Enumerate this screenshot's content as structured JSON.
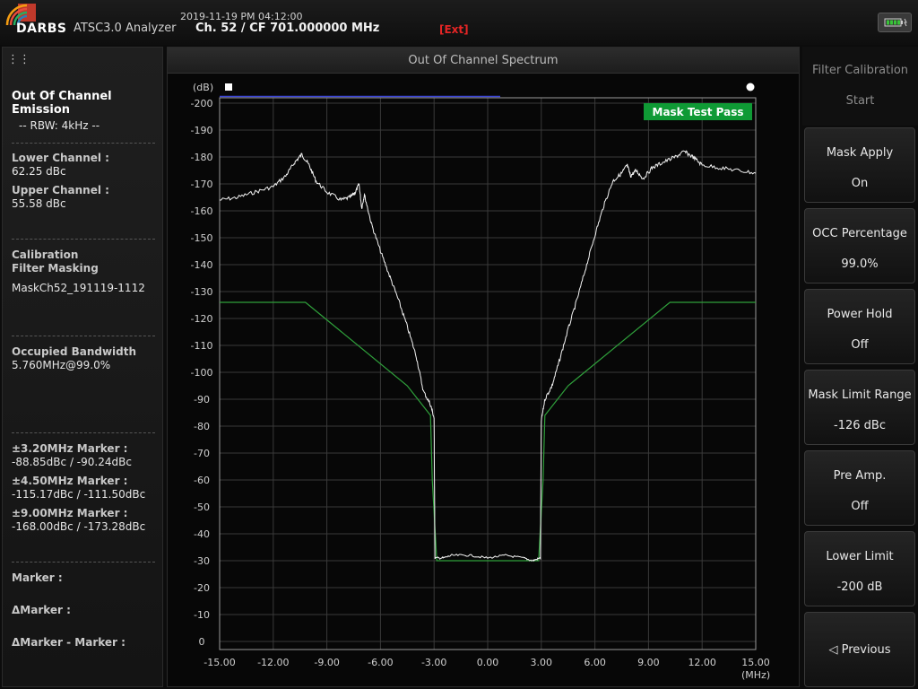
{
  "header": {
    "logo_text": "DARBS",
    "app_title": "ATSC3.0 Analyzer",
    "datetime": "2019-11-19 PM 04:12:00",
    "channel_info": "Ch. 52 / CF 701.000000 MHz",
    "ext_tag": "[Ext]",
    "icons": {
      "logo": "darbs-logo-icon",
      "battery": "battery-icon",
      "handle": "drag-handle-icon"
    }
  },
  "left_panel": {
    "title": "Out Of Channel Emission",
    "rbw": "-- RBW: 4kHz --",
    "lower_channel_label": "Lower Channel :",
    "lower_channel_value": "62.25 dBc",
    "upper_channel_label": "Upper Channel :",
    "upper_channel_value": "55.58 dBc",
    "calibration_label_1": "Calibration",
    "calibration_label_2": "Filter Masking",
    "mask_name": "MaskCh52_191119-1112",
    "occupied_bw_label": "Occupied Bandwidth",
    "occupied_bw_value": "5.760MHz@99.0%",
    "markers": [
      {
        "label": "±3.20MHz Marker :",
        "value": "-88.85dBc / -90.24dBc"
      },
      {
        "label": "±4.50MHz Marker :",
        "value": "-115.17dBc / -111.50dBc"
      },
      {
        "label": "±9.00MHz Marker :",
        "value": "-168.00dBc / -173.28dBc"
      }
    ],
    "marker_label": "Marker :",
    "delta_marker_label": "ΔMarker :",
    "delta_marker_minus_label": "ΔMarker - Marker :"
  },
  "center_panel": {
    "title": "Out Of Channel Spectrum",
    "badge": "Mask Test Pass"
  },
  "chart_data": {
    "type": "line",
    "ylabel": "(dB)",
    "xlabel": "(MHz)",
    "xlim": [
      -15,
      15
    ],
    "ylim": [
      -200,
      0
    ],
    "x_ticks": [
      -15,
      -12,
      -9,
      -6,
      -3,
      0,
      3,
      6,
      9,
      12,
      15
    ],
    "x_tick_labels": [
      "-15.00",
      "-12.00",
      "-9.00",
      "-6.00",
      "-3.00",
      "0.00",
      "3.00",
      "6.00",
      "9.00",
      "12.00",
      "15.00"
    ],
    "y_ticks": [
      0,
      -10,
      -20,
      -30,
      -40,
      -50,
      -60,
      -70,
      -80,
      -90,
      -100,
      -110,
      -120,
      -130,
      -140,
      -150,
      -160,
      -170,
      -180,
      -190,
      -200
    ],
    "grid": true,
    "colors": {
      "spectrum": "#f4f4f4",
      "mask": "#2fa03b",
      "baseline": "#3b45d8",
      "badge": "#0f9a35",
      "grid": "#3a3a3a"
    },
    "series": [
      {
        "role": "spectrum",
        "x": [
          -15,
          -14,
          -13,
          -12,
          -11.3,
          -10.8,
          -10.4,
          -10,
          -9.6,
          -9,
          -8.2,
          -7.7,
          -7.4,
          -7.2,
          -7.05,
          -6.9,
          -6.5,
          -6,
          -5.5,
          -5,
          -4.5,
          -4,
          -3.6,
          -3.2,
          -3,
          -2.95,
          -2.5,
          -2,
          -1,
          0,
          1,
          2,
          2.5,
          2.95,
          3,
          3.2,
          3.6,
          4,
          4.5,
          5,
          5.5,
          6,
          6.5,
          7,
          7.5,
          7.8,
          8,
          8.3,
          8.7,
          9.2,
          9.8,
          10.5,
          11,
          11.5,
          12,
          13,
          14,
          15
        ],
        "y": [
          -164,
          -165,
          -167,
          -169,
          -173,
          -178,
          -181,
          -177,
          -171,
          -167,
          -164,
          -165,
          -167,
          -170,
          -161,
          -166,
          -155,
          -145,
          -136,
          -127,
          -117,
          -106,
          -93,
          -88,
          -83,
          -31,
          -31,
          -32,
          -32,
          -31,
          -32,
          -31,
          -30,
          -31,
          -82,
          -90,
          -95,
          -104,
          -116,
          -127,
          -139,
          -151,
          -162,
          -171,
          -174,
          -177,
          -173,
          -175,
          -172,
          -176,
          -178,
          -180,
          -182,
          -180,
          -177,
          -176,
          -175,
          -174
        ]
      },
      {
        "role": "mask",
        "x": [
          -15,
          -10.2,
          -4.5,
          -3.2,
          -3.1,
          -2.85,
          2.85,
          3.1,
          3.2,
          4.5,
          10.2,
          15
        ],
        "y": [
          -126,
          -126,
          -95,
          -84,
          -60,
          -30,
          -30,
          -60,
          -84,
          -95,
          -126,
          -126
        ]
      },
      {
        "role": "baseline",
        "x": [
          -15,
          0.7
        ],
        "y": [
          -202.5,
          -202.5
        ]
      }
    ]
  },
  "right_panel": {
    "filter_cal_label": "Filter Calibration",
    "filter_cal_value": "Start",
    "buttons": [
      {
        "label": "Mask Apply",
        "value": "On"
      },
      {
        "label": "OCC Percentage",
        "value": "99.0%"
      },
      {
        "label": "Power Hold",
        "value": "Off"
      },
      {
        "label": "Mask Limit Range",
        "value": "-126 dBc"
      },
      {
        "label": "Pre Amp.",
        "value": "Off"
      },
      {
        "label": "Lower Limit",
        "value": "-200 dB"
      }
    ],
    "previous_label": "◁ Previous"
  }
}
